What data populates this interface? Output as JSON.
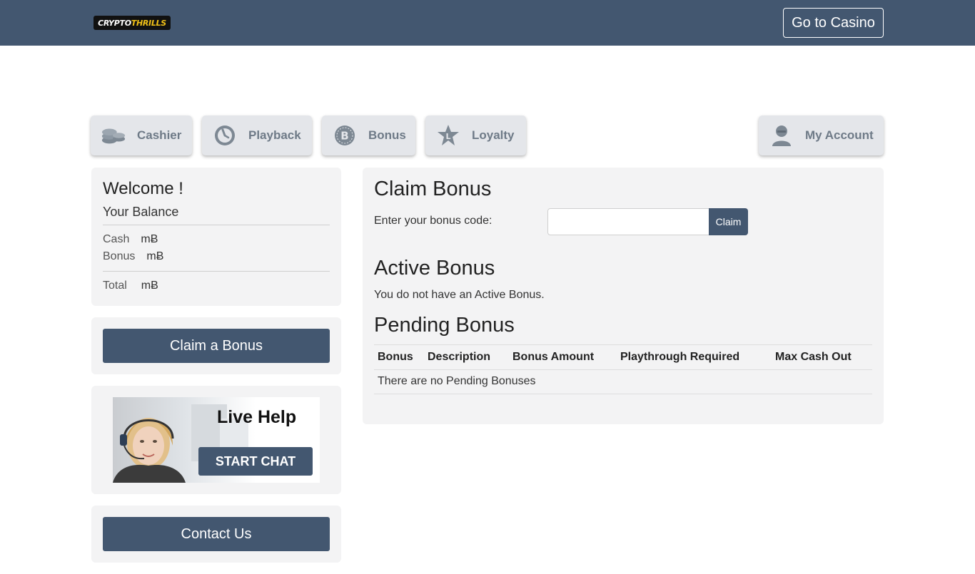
{
  "header": {
    "logo_left": "CRYPTO",
    "logo_right": "THRILLS",
    "go_to_casino": "Go to Casino"
  },
  "nav": {
    "cashier": "Cashier",
    "playback": "Playback",
    "bonus": "Bonus",
    "loyalty": "Loyalty",
    "my_account": "My Account"
  },
  "sidebar": {
    "welcome": "Welcome !",
    "your_balance": "Your Balance",
    "cash_label": "Cash",
    "cash_currency": "mɃ",
    "bonus_label": "Bonus",
    "bonus_currency": "mɃ",
    "total_label": "Total",
    "total_currency": "mɃ",
    "claim_bonus_btn": "Claim a Bonus",
    "live_help_title": "Live Help",
    "start_chat": "START CHAT",
    "contact_us": "Contact Us"
  },
  "main": {
    "claim_title": "Claim Bonus",
    "code_label": "Enter your bonus code:",
    "code_value": "",
    "claim_btn": "Claim",
    "active_title": "Active Bonus",
    "active_msg": "You do not have an Active Bonus.",
    "pending_title": "Pending Bonus",
    "columns": [
      "Bonus",
      "Description",
      "Bonus Amount",
      "Playthrough Required",
      "Max Cash Out"
    ],
    "empty_msg": "There are no Pending Bonuses"
  },
  "colors": {
    "brand": "#435770",
    "panel": "#f3f3f4",
    "nav_button": "#e4e6ea",
    "logo_accent": "#f2c218"
  }
}
